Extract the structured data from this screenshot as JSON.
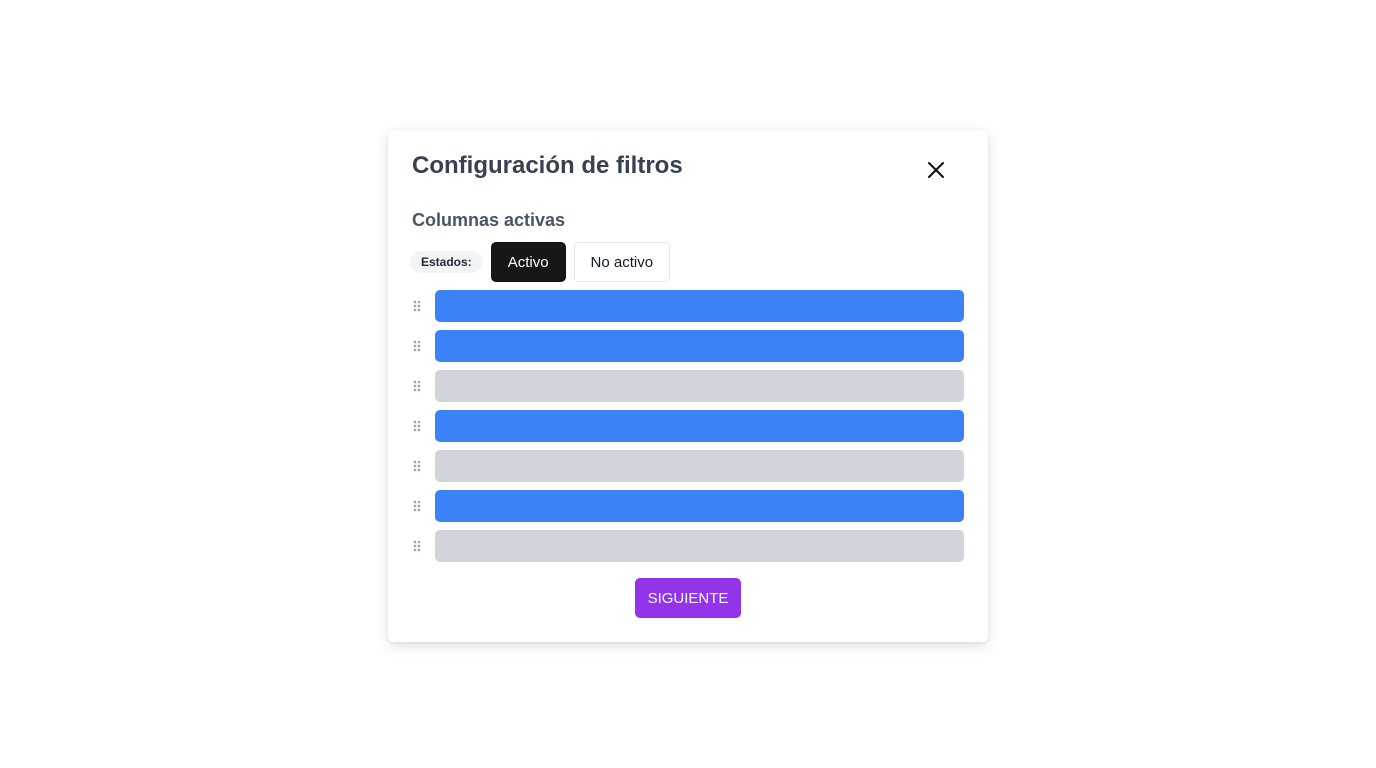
{
  "modal": {
    "title": "Configuración de filtros",
    "section_title": "Columnas activas",
    "close_icon": "close-icon"
  },
  "states": {
    "label": "Estados:",
    "active_label": "Activo",
    "inactive_label": "No activo",
    "selected": "Activo"
  },
  "colors": {
    "active_column": "#3b82f6",
    "inactive_column": "#d1d5db",
    "primary_button": "#9333ea",
    "selected_state": "#171717"
  },
  "columns": [
    {
      "active": true
    },
    {
      "active": true
    },
    {
      "active": false
    },
    {
      "active": true
    },
    {
      "active": false
    },
    {
      "active": true
    },
    {
      "active": false
    }
  ],
  "footer": {
    "next_label": "SIGUIENTE"
  }
}
